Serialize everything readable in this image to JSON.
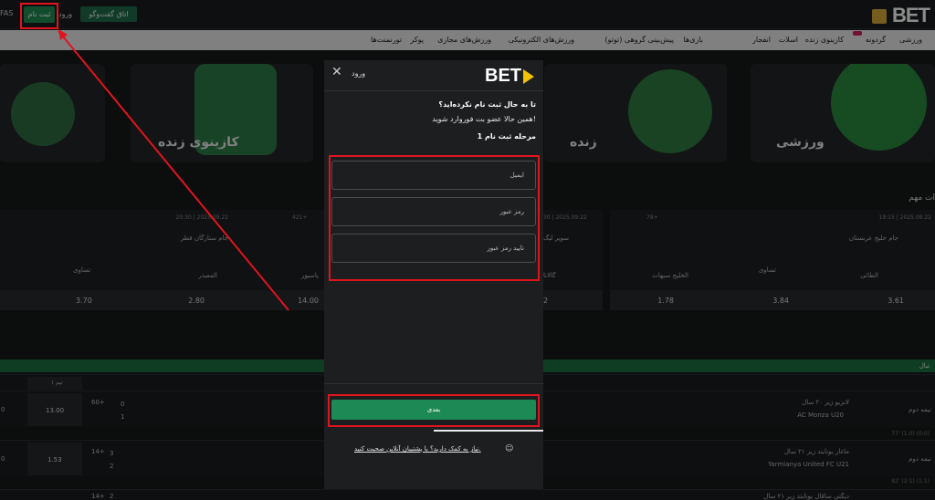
{
  "header": {
    "logo_text": "BET",
    "fas_text": "FAS",
    "register_label": "ثبت نام",
    "login_label": "ورود",
    "chat_label": "اتاق گفت‌وگو"
  },
  "nav": {
    "items": [
      "ورزشی",
      "گردونه",
      "کازینوی زنده",
      "اسلات",
      "انفجار",
      "بازی‌ها",
      "پیش‌بینی گروهی (توتو)",
      "ورزش‌های الکترونیکی",
      "ورزش‌های مجازی",
      "پوکر",
      "تورنمنت‌ها"
    ]
  },
  "banners": {
    "sports": "ورزشی",
    "live": "زنده",
    "live_casino": "کازینوی زنده"
  },
  "section_title": "ات مهم",
  "matches": [
    {
      "meta": "19:15 | 2025.09.22",
      "count": "78+",
      "league": "جام خلیج عربستان",
      "home": "الطائی",
      "away": "الخلیج سیهات",
      "draw_label": "تساوی",
      "odds": [
        "3.61",
        "3.84",
        "1.78"
      ]
    },
    {
      "meta": "30 | 2025.09.22",
      "count": "",
      "league": "سوپر لیگ",
      "home": "گالاتا",
      "away": "",
      "draw_label": "",
      "odds": [
        "2",
        "",
        ""
      ]
    },
    {
      "meta": "",
      "count": "421+",
      "league": "",
      "home": "پاسپور",
      "away": "",
      "draw_label": "",
      "odds": [
        "14.00",
        "",
        ""
      ]
    },
    {
      "meta": "20:30 | 2025.09.22",
      "count": "",
      "league": "جام ستارگان قطر",
      "home": "المعیذر",
      "away": "",
      "draw_label": "تساوی",
      "odds": [
        "2.80",
        "3.70",
        ""
      ]
    }
  ],
  "table": {
    "league_label": "تبال",
    "team_col": "تیم ۱",
    "rows": [
      {
        "home": "لانزیو زیر ۲۰ سال",
        "away": "AC Monza U20",
        "half": "نیمه دوم",
        "more": "60+",
        "score_home": "0",
        "score_away": "1",
        "odd": "13.00",
        "odd_left": "0",
        "subline": "77' (1:0) (0:0)"
      },
      {
        "home": "ماغار یونایتد زیر ۲۱ سال",
        "away": "Yarmianya United FC U21",
        "half": "نیمه دوم",
        "more": "14+",
        "score_home": "3",
        "score_away": "2",
        "odd": "1.53",
        "odd_left": "0",
        "subline": "82' (2:1) (1:1)"
      },
      {
        "home": "دیگتی ساقال یونایتد زیر ۲۱ سال",
        "away": "",
        "half": "",
        "more": "14+",
        "score_home": "2",
        "score_away": "",
        "odd": "",
        "odd_left": "",
        "subline": ""
      }
    ]
  },
  "modal": {
    "logo": "BET",
    "login_label": "ورود",
    "close_label": "✕",
    "question": "تا به حال ثبت نام نکرده‌اید؟",
    "invite": "همین حالا عضو بت فوروارد شوید!",
    "step": "مرحله ثبت نام 1",
    "email_placeholder": "ایمیل",
    "password_placeholder": "رمز عبور",
    "confirm_placeholder": "تایید رمز عبور",
    "next_label": "بعدی",
    "help_text": "نیاز به کمک دارید؟ با پشتیبان آنلاین صحبت کنید."
  },
  "colors": {
    "brand_green": "#1d8a55",
    "accent_yellow": "#f2c100",
    "highlight_red": "#e0141e"
  }
}
